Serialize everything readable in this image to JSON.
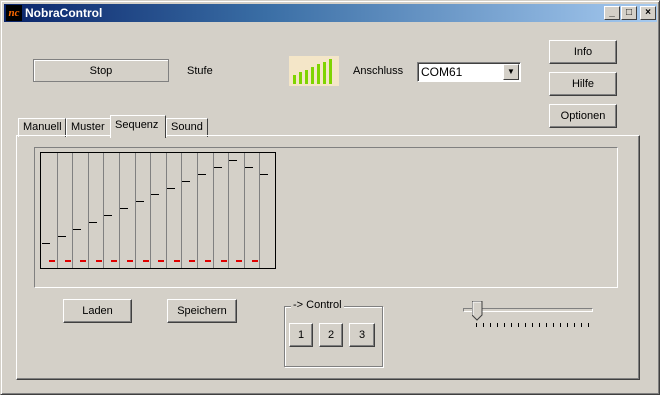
{
  "window": {
    "title": "NobraControl",
    "icon_text": "ᴺᶜ"
  },
  "titlebar_buttons": {
    "minimize": "_",
    "maximize": "□",
    "close": "×"
  },
  "top": {
    "stop_label": "Stop",
    "stufe_label": "Stufe",
    "signal_bars": [
      0.35,
      0.45,
      0.55,
      0.65,
      0.75,
      0.85,
      0.95
    ],
    "anschluss_label": "Anschluss",
    "port_value": "COM61"
  },
  "side_buttons": {
    "info": "Info",
    "hilfe": "Hilfe",
    "optionen": "Optionen"
  },
  "tabs": [
    {
      "label": "Manuell"
    },
    {
      "label": "Muster"
    },
    {
      "label": "Sequenz"
    },
    {
      "label": "Sound"
    }
  ],
  "active_tab": "Sequenz",
  "sequence": {
    "levels": [
      0.22,
      0.28,
      0.34,
      0.4,
      0.46,
      0.52,
      0.58,
      0.64,
      0.7,
      0.76,
      0.82,
      0.88,
      0.94,
      0.88,
      0.82
    ],
    "min_levels": [
      0.07,
      0.07,
      0.07,
      0.07,
      0.07,
      0.07,
      0.07,
      0.07,
      0.07,
      0.07,
      0.07,
      0.07,
      0.07,
      0.07
    ]
  },
  "buttons": {
    "laden": "Laden",
    "speichern": "Speichern"
  },
  "control_group": {
    "legend": "-> Control",
    "buttons": [
      "1",
      "2",
      "3"
    ]
  },
  "slider": {
    "value": 0.08
  },
  "colors": {
    "title_start": "#0a246a",
    "title_end": "#a6caf0",
    "signal_bar": "#7fd400",
    "min_marker": "#e00000"
  }
}
